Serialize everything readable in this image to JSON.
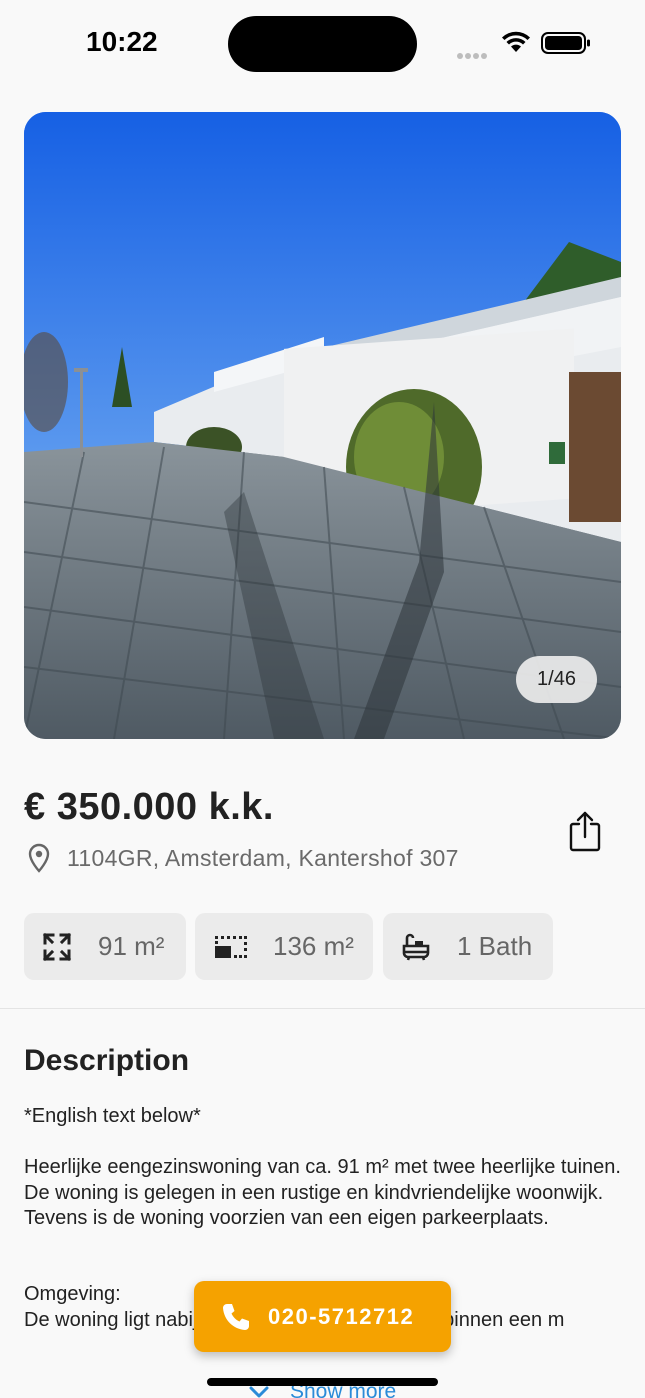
{
  "status_bar": {
    "time": "10:22"
  },
  "photo": {
    "counter": "1/46"
  },
  "listing": {
    "price": "€ 350.000 k.k.",
    "address": "1104GR, Amsterdam, Kantershof 307"
  },
  "features": [
    {
      "icon": "expand-arrows-icon",
      "label": "91 m²"
    },
    {
      "icon": "plot-area-icon",
      "label": "136 m²"
    },
    {
      "icon": "bathtub-icon",
      "label": "1 Bath"
    }
  ],
  "description": {
    "title": "Description",
    "paragraphs": [
      "*English text below*",
      "Heerlijke eengezinswoning van ca. 91 m² met twee heerlijke tuinen. De woning is gelegen in een rustige en kindvriendelijke woonwijk. Tevens is de woning voorzien van een eigen parkeerplaats.",
      "Omgeving:\nDe woning ligt nabij de Gaasperplas en je bent binnen een m"
    ],
    "show_more": "Show more"
  },
  "call": {
    "phone": "020-5712712"
  },
  "colors": {
    "accent": "#f5a200",
    "link": "#2a8bd8",
    "chip_bg": "#ebebeb"
  }
}
